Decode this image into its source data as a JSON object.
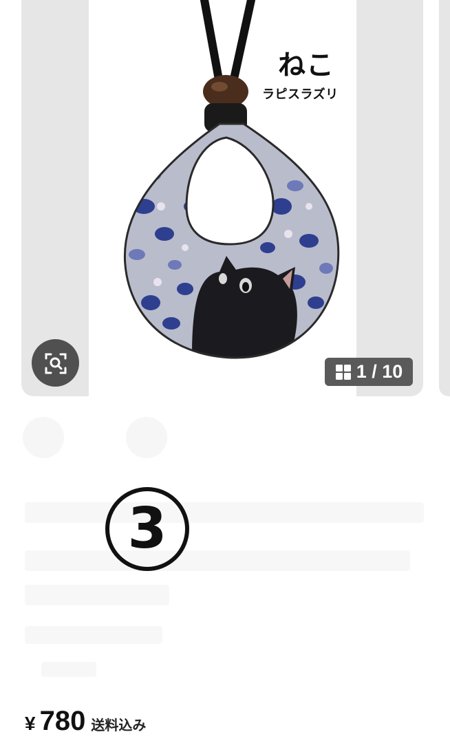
{
  "product_image": {
    "title": "ねこ",
    "subtitle": "ラピスラズリ"
  },
  "image_search": {
    "icon": "image-search-icon"
  },
  "image_counter": {
    "icon": "grid-icon",
    "text": "1 / 10"
  },
  "annotation": {
    "circled_number": "③"
  },
  "price": {
    "currency": "¥",
    "value": "780",
    "shipping_label": "送料込み"
  }
}
